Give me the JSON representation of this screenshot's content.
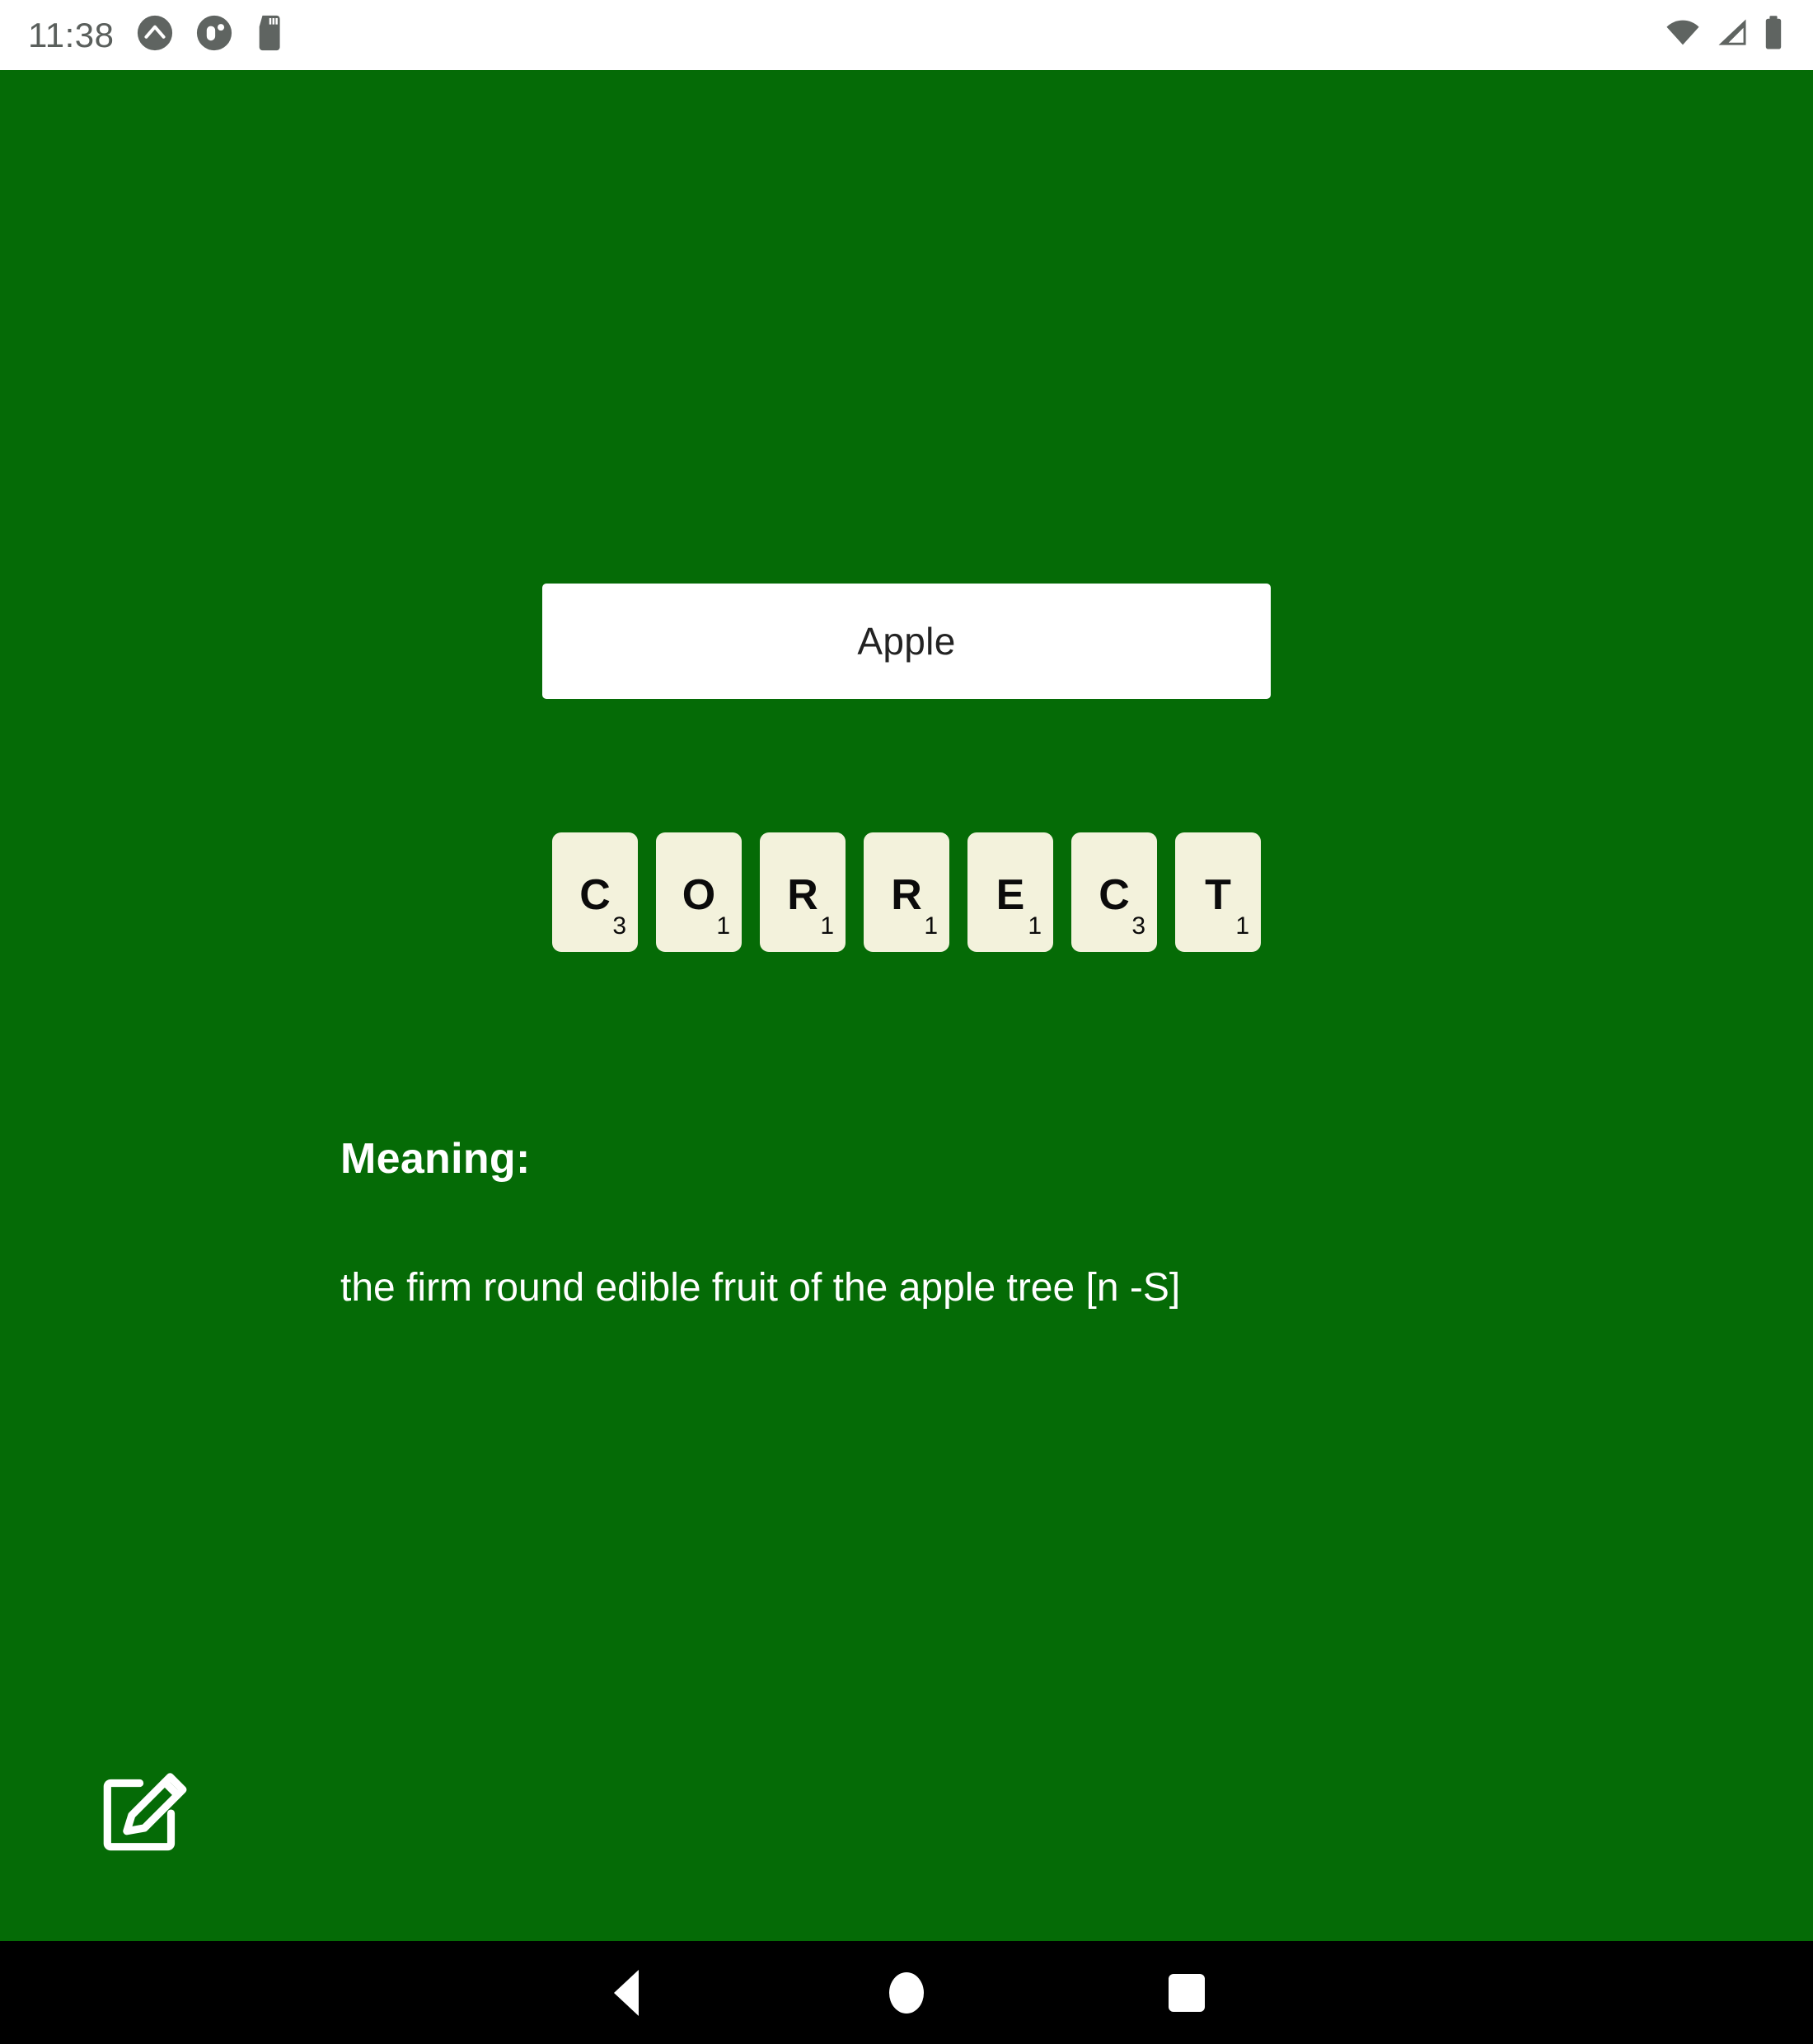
{
  "status_bar": {
    "time": "11:38",
    "notification_icons": [
      "chevron-up-circle-icon",
      "key-circle-icon",
      "sd-card-icon"
    ],
    "system_icons": [
      "wifi-icon",
      "cellular-signal-icon",
      "battery-icon"
    ]
  },
  "app": {
    "background_color": "#056B06",
    "word_card": {
      "word": "Apple",
      "background_color": "#FFFFFF",
      "text_color": "#232323"
    },
    "result_tiles": {
      "word": "CORRECT",
      "tile_color": "#F3F2DC",
      "tiles": [
        {
          "letter": "C",
          "value": "3"
        },
        {
          "letter": "O",
          "value": "1"
        },
        {
          "letter": "R",
          "value": "1"
        },
        {
          "letter": "R",
          "value": "1"
        },
        {
          "letter": "E",
          "value": "1"
        },
        {
          "letter": "C",
          "value": "3"
        },
        {
          "letter": "T",
          "value": "1"
        }
      ]
    },
    "meaning": {
      "heading": "Meaning:",
      "text": "the firm round edible fruit of the apple tree [n -S]"
    },
    "edit_button": {
      "icon": "edit-compose-icon",
      "color": "#FFFFFF"
    }
  },
  "nav_bar": {
    "background_color": "#000000",
    "buttons": [
      {
        "name": "back",
        "icon": "triangle-back-icon"
      },
      {
        "name": "home",
        "icon": "circle-home-icon"
      },
      {
        "name": "recents",
        "icon": "square-recents-icon"
      }
    ]
  }
}
